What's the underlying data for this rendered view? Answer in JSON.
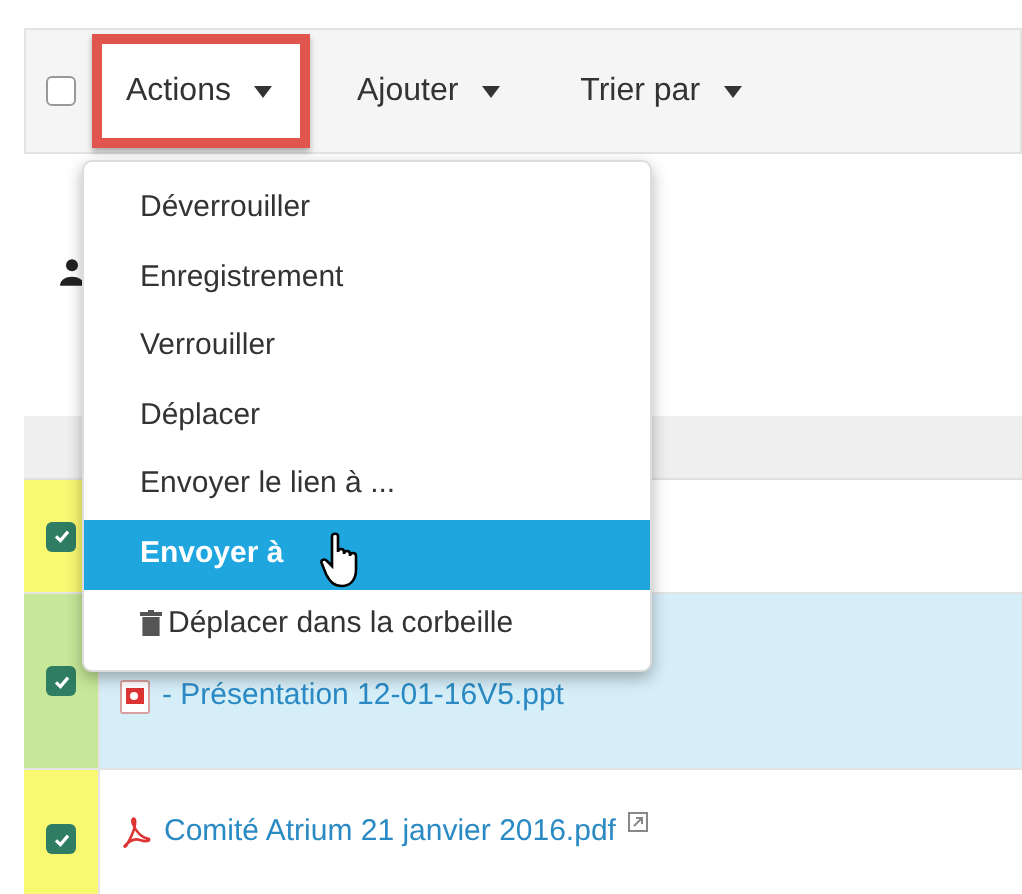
{
  "toolbar": {
    "select_all": {
      "checked": false
    },
    "buttons": [
      {
        "label": "Actions",
        "highlighted": true
      },
      {
        "label": "Ajouter",
        "highlighted": false
      },
      {
        "label": "Trier par",
        "highlighted": false
      }
    ]
  },
  "menu": {
    "items": [
      {
        "label": "Déverrouiller",
        "kind": "plain",
        "selected": false
      },
      {
        "label": "Enregistrement",
        "kind": "plain",
        "selected": false
      },
      {
        "label": "Verrouiller",
        "kind": "plain",
        "selected": false
      },
      {
        "label": "Déplacer",
        "kind": "plain",
        "selected": false
      },
      {
        "label": "Envoyer le lien à ...",
        "kind": "plain",
        "selected": false
      },
      {
        "label": "Envoyer à",
        "kind": "plain",
        "selected": true
      },
      {
        "label": "Déplacer dans la corbeille",
        "kind": "trash",
        "selected": false
      }
    ]
  },
  "files": [
    {
      "checked": true,
      "selected": false
    },
    {
      "name": "- Présentation 12-01-16V5.ppt",
      "kind": "ppt",
      "checked": true,
      "selected": true,
      "external": false
    },
    {
      "name": "Comité Atrium 21 janvier 2016.pdf",
      "kind": "pdf",
      "checked": true,
      "selected": false,
      "external": true
    }
  ]
}
